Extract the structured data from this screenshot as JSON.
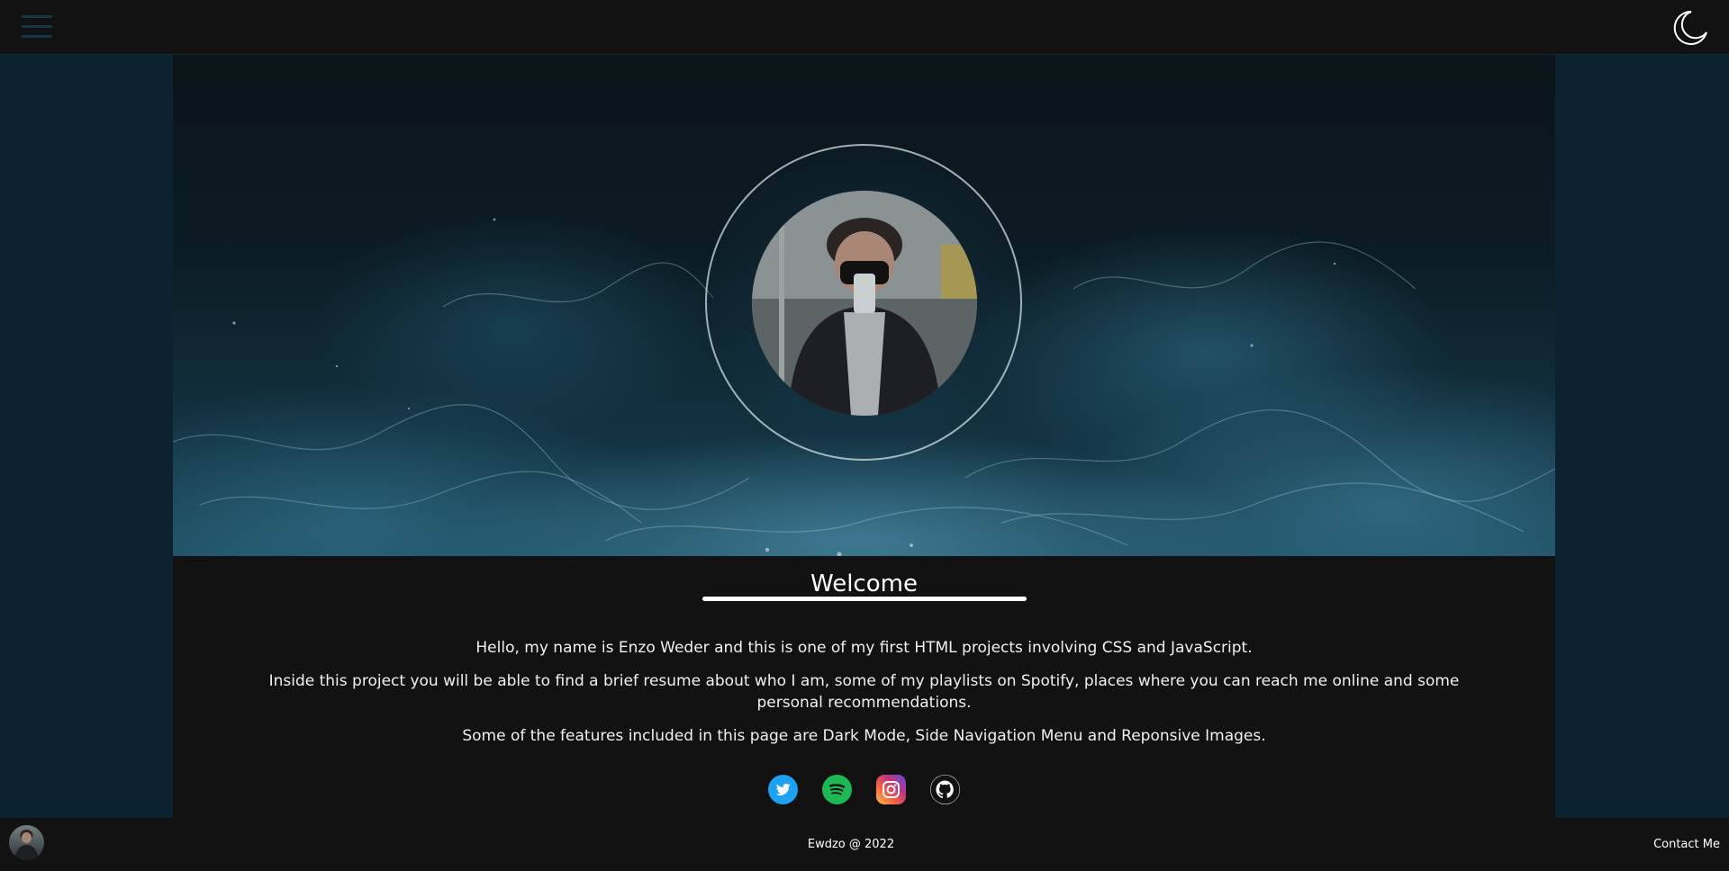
{
  "header": {
    "menu_icon": "hamburger-menu-icon",
    "theme_icon": "moon-icon"
  },
  "hero": {
    "background": "ocean-waves-image",
    "profile_photo": "profile-photo"
  },
  "main": {
    "heading": "Welcome",
    "paragraphs": [
      "Hello, my name is Enzo Weder and this is one of my first HTML projects involving CSS and JavaScript.",
      "Inside this project you will be able to find a brief resume about who I am, some of my playlists on Spotify, places where you can reach me online and some personal recommendations.",
      "Some of the features included in this page are Dark Mode, Side Navigation Menu and Reponsive Images."
    ],
    "socials": [
      {
        "name": "twitter-icon",
        "color": "#1da1f2"
      },
      {
        "name": "spotify-icon",
        "color": "#1db954"
      },
      {
        "name": "instagram-icon",
        "color": "#c13584"
      },
      {
        "name": "github-icon",
        "color": "#ffffff"
      }
    ]
  },
  "footer": {
    "copyright": "Ewdzo @ 2022",
    "contact_label": "Contact Me"
  },
  "colors": {
    "page_bg": "#121212",
    "side_bg": "#0b2331",
    "accent": "#14384a",
    "text": "#ffffff"
  }
}
